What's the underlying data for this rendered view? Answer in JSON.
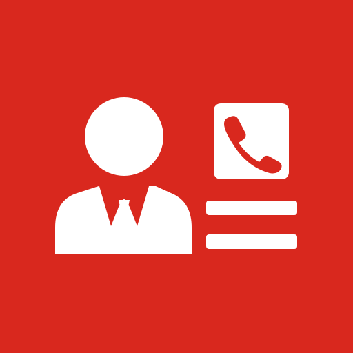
{
  "icon": {
    "name": "contact-card-icon",
    "parts": [
      "person-icon",
      "tie-icon",
      "phone-icon",
      "text-lines-icon"
    ]
  },
  "colors": {
    "background": "#d9281e",
    "foreground": "#ffffff"
  }
}
